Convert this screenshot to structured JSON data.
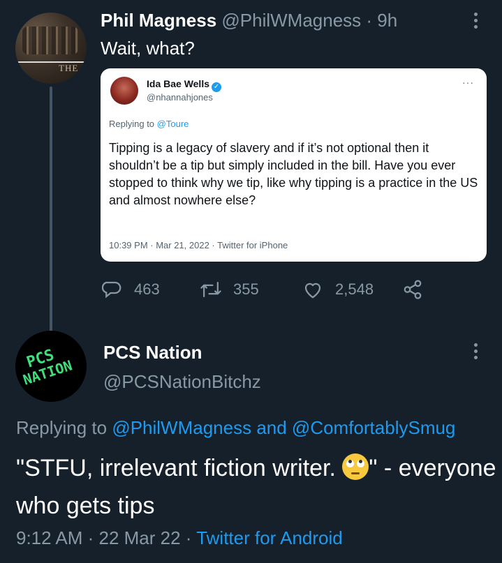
{
  "tweet": {
    "author_name": "Phil Magness",
    "author_handle": "@PhilWMagness",
    "time_ago": "· 9h",
    "text": "Wait, what?",
    "avatar_word": "THE",
    "quoted": {
      "author_name": "Ida Bae Wells",
      "author_handle": "@nhannahjones",
      "more": "···",
      "replying_prefix": "Replying to",
      "replying_to": "@Toure",
      "text": "Tipping is a legacy of slavery and if it’s not optional then it shouldn’t be a tip but simply included in the bill. Have you ever stopped to think why we tip, like why tipping is a practice in the US and almost nowhere else?",
      "timestamp": "10:39 PM · Mar 21, 2022 · Twitter for iPhone"
    },
    "actions": {
      "replies": "463",
      "retweets": "355",
      "likes": "2,548"
    },
    "icons": [
      "reply-icon",
      "retweet-icon",
      "like-icon",
      "share-icon",
      "more-icon",
      "verified-icon"
    ]
  },
  "reply_tweet": {
    "avatar_text_1": "PCS",
    "avatar_text_2": "NATION",
    "author_name": "PCS Nation",
    "author_handle": "@PCSNationBitchz",
    "replying_prefix": "Replying to",
    "replying_to": "@PhilWMagness and @ComfortablySmug",
    "text_before_emoji": "\"STFU, irrelevant fiction writer. ",
    "text_after_emoji": "\" - everyone who gets tips",
    "emoji": "face-with-rolling-eyes",
    "time": "9:12 AM · 22 Mar 22 · ",
    "source": "Twitter for Android"
  },
  "colors": {
    "background": "#15202b",
    "secondary_text": "#8899a6",
    "link": "#1d9bf0",
    "accent_green": "#3ee07a"
  }
}
